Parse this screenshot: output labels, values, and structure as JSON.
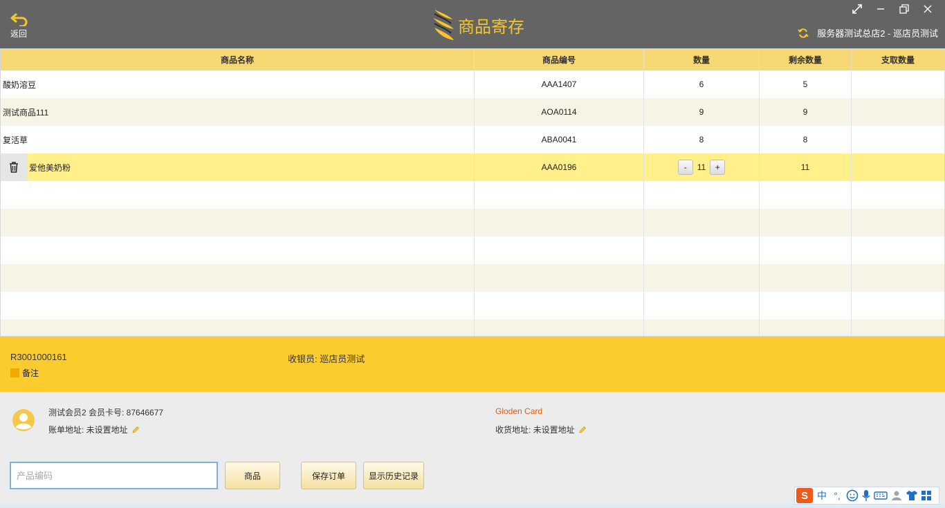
{
  "header": {
    "back_label": "返回",
    "title": "商品寄存",
    "store": "服务器测试总店2 - 巡店员测试"
  },
  "table": {
    "columns": [
      "商品名称",
      "商品编号",
      "数量",
      "剩余数量",
      "支取数量"
    ],
    "rows": [
      {
        "name": "酸奶溶豆",
        "code": "AAA1407",
        "qty": "6",
        "remaining": "5",
        "withdraw": ""
      },
      {
        "name": "测试商品111",
        "code": "AOA0114",
        "qty": "9",
        "remaining": "9",
        "withdraw": ""
      },
      {
        "name": "复活草",
        "code": "ABA0041",
        "qty": "8",
        "remaining": "8",
        "withdraw": ""
      },
      {
        "name": "爱他美奶粉",
        "code": "AAA0196",
        "qty": "11",
        "remaining": "11",
        "withdraw": ""
      }
    ],
    "stepper": {
      "minus": "-",
      "plus": "+"
    }
  },
  "order": {
    "number": "R3001000161",
    "note_label": "备注",
    "cashier": "收银员: 巡店员测试"
  },
  "member": {
    "info": "测试会员2 会员卡号: 87646677",
    "billing": "账单地址: 未设置地址",
    "card": "Gloden Card",
    "shipping": "收货地址: 未设置地址"
  },
  "actions": {
    "code_placeholder": "产品编码",
    "goods": "商品",
    "save": "保存订单",
    "history": "显示历史记录"
  },
  "ime": {
    "logo": "S",
    "mode": "中",
    "punct": "°,"
  },
  "colors": {
    "header_bg": "#646464",
    "title": "#f5c62a",
    "table_header": "#f6d975",
    "selected_row": "#fff08c",
    "order_band": "#fccb2d",
    "card": "#e45a10"
  }
}
